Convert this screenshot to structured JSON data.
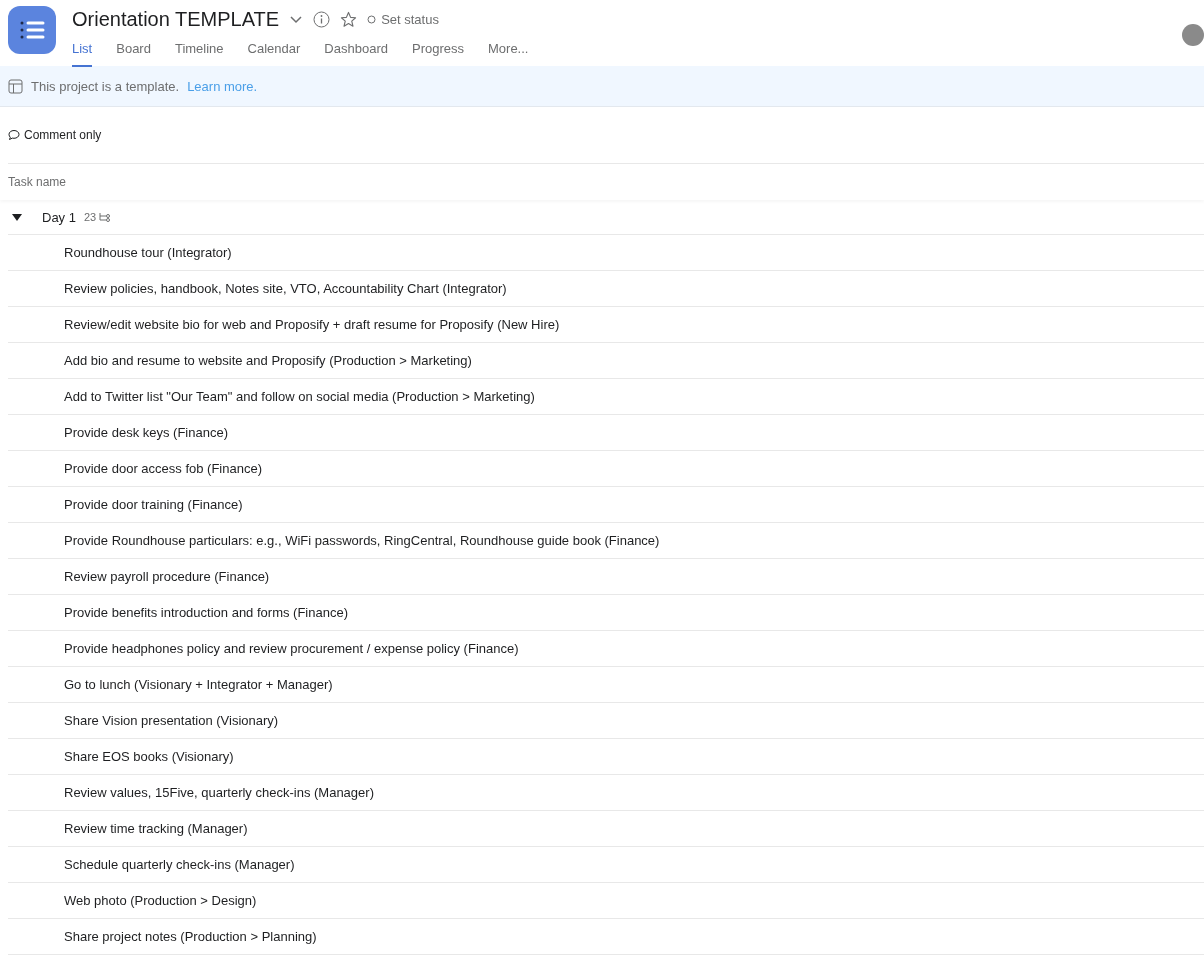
{
  "project": {
    "title": "Orientation TEMPLATE",
    "status": "Set status"
  },
  "tabs": [
    {
      "label": "List",
      "selected": true
    },
    {
      "label": "Board",
      "selected": false
    },
    {
      "label": "Timeline",
      "selected": false
    },
    {
      "label": "Calendar",
      "selected": false
    },
    {
      "label": "Dashboard",
      "selected": false
    },
    {
      "label": "Progress",
      "selected": false
    },
    {
      "label": "More...",
      "selected": false
    }
  ],
  "banner": {
    "text": "This project is a template.",
    "link": "Learn more."
  },
  "permission": "Comment only",
  "table": {
    "column": "Task name",
    "section": {
      "name": "Day 1",
      "count": "23",
      "expanded": true,
      "tasks": [
        "Roundhouse tour (Integrator)",
        "Review policies, handbook, Notes site, VTO, Accountability Chart (Integrator)",
        "Review/edit website bio for web and Proposify + draft resume for Proposify (New Hire)",
        "Add bio and resume to website and Proposify (Production > Marketing)",
        "Add to Twitter list \"Our Team\" and follow on social media (Production > Marketing)",
        "Provide desk keys (Finance)",
        "Provide door access fob (Finance)",
        "Provide door training (Finance)",
        "Provide Roundhouse particulars: e.g., WiFi passwords, RingCentral, Roundhouse guide book (Finance)",
        "Review payroll procedure (Finance)",
        "Provide benefits introduction and forms (Finance)",
        "Provide headphones policy and review procurement / expense policy (Finance)",
        "Go to lunch (Visionary + Integrator + Manager)",
        "Share Vision presentation (Visionary)",
        "Share EOS books (Visionary)",
        "Review values, 15Five, quarterly check-ins (Manager)",
        "Review time tracking (Manager)",
        "Schedule quarterly check-ins (Manager)",
        "Web photo (Production > Design)",
        "Share project notes (Production > Planning)"
      ]
    }
  }
}
